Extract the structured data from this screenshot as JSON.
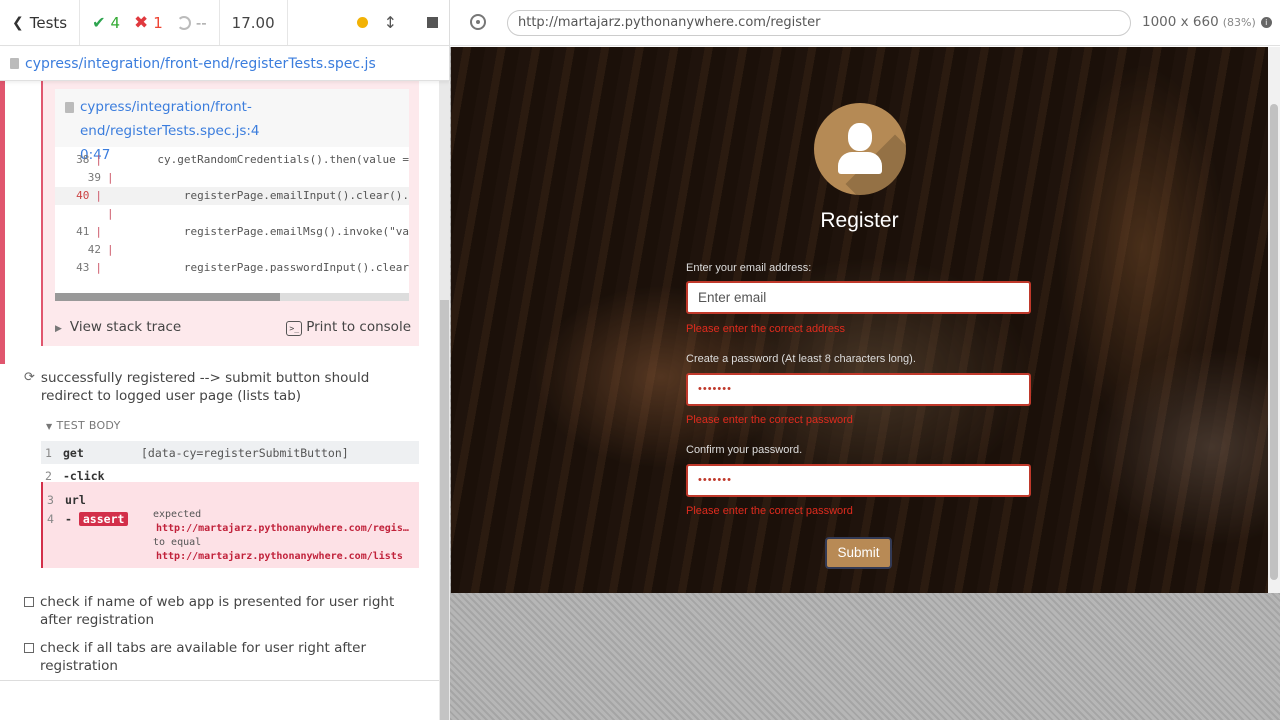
{
  "stats": {
    "tests_label": "Tests",
    "passed": "4",
    "failed": "1",
    "pending": "--",
    "duration": "17.00"
  },
  "spec": {
    "path": "cypress/integration/front-end/registerTests.spec.js"
  },
  "error": {
    "code_file_line1": "cypress/integration/front-end/registerTests.spec.js:4",
    "code_file_line2": "0:47",
    "code_lines": [
      {
        "num": "38",
        "marker": "",
        "src": "        cy.getRandomCredentials().then(value =",
        "hl": false
      },
      {
        "num": "39",
        "marker": "",
        "src": "",
        "hl": false
      },
      {
        "num": "40",
        "marker": "> ",
        "src": "            registerPage.emailInput().clear().",
        "hl": true
      },
      {
        "num": "",
        "marker": "",
        "src": "",
        "hl": false
      },
      {
        "num": "41",
        "marker": "",
        "src": "            registerPage.emailMsg().invoke(\"va",
        "hl": false
      },
      {
        "num": "42",
        "marker": "",
        "src": "",
        "hl": false
      },
      {
        "num": "43",
        "marker": "",
        "src": "            registerPage.passwordInput().clear",
        "hl": false
      }
    ],
    "view_stack_trace": "View stack trace",
    "print_to_console": "Print to console"
  },
  "tests": {
    "current": "successfully registered --> submit button should redirect to logged user page (lists tab)",
    "pending1": "check if name of web app is presented for user right after registration",
    "pending2": "check if all tabs are available for user right after registration"
  },
  "test_body": {
    "header": "TEST BODY",
    "commands": [
      {
        "num": "1",
        "name": "get",
        "msg": "[data-cy=registerSubmitButton]"
      },
      {
        "num": "2",
        "name": "-click",
        "msg": ""
      },
      {
        "num": "3",
        "name": "url",
        "msg": ""
      },
      {
        "num": "4",
        "name": "-",
        "badge": "assert"
      }
    ],
    "assert_expected": "expected",
    "assert_actual": "http://martajarz.pythonanywhere.com/regis…",
    "assert_to_equal": "to equal",
    "assert_target": "http://martajarz.pythonanywhere.com/lists"
  },
  "aut": {
    "url": "http://martajarz.pythonanywhere.com/register",
    "viewport": "1000 x 660",
    "scale": "(83%)"
  },
  "register_form": {
    "title": "Register",
    "email_label": "Enter your email address:",
    "email_placeholder": "Enter email",
    "email_error": "Please enter the correct address",
    "password_label": "Create a password (At least 8 characters long).",
    "password_value": "•••••••",
    "password_error": "Please enter the correct password",
    "confirm_label": "Confirm your password.",
    "confirm_value": "•••••••",
    "confirm_error": "Please enter the correct password",
    "submit_label": "Submit"
  },
  "colors": {
    "passed": "#2ea44f",
    "failed": "#e0393e",
    "accent_link": "#3b7ddd",
    "form_error": "#e02b1e",
    "submit_bg": "#b88a55"
  }
}
